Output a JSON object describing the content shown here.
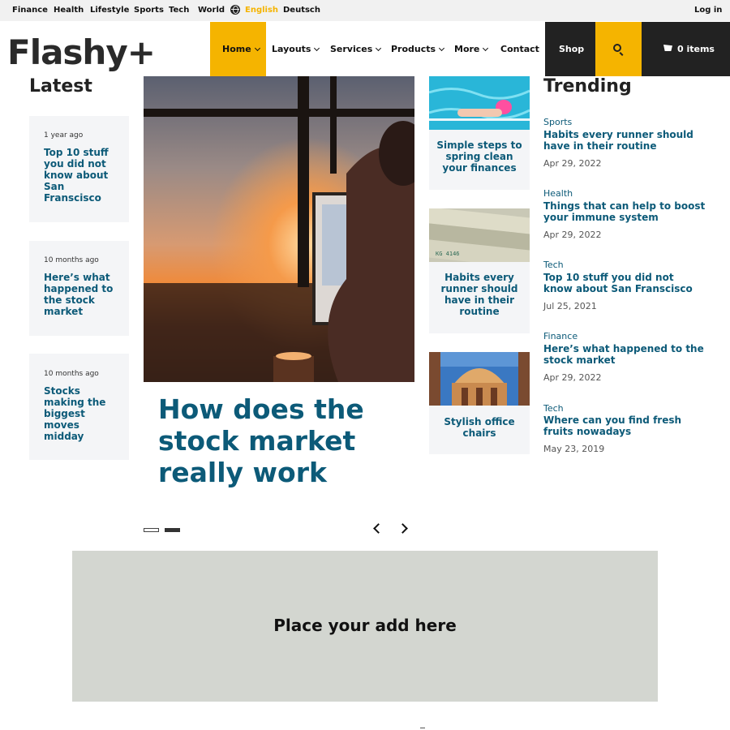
{
  "topbar": {
    "links": [
      "Finance",
      "Health",
      "Lifestyle",
      "Sports",
      "Tech",
      "World"
    ],
    "languages": [
      "English",
      "Deutsch"
    ],
    "login": "Log in"
  },
  "header": {
    "logo": "Flashy+",
    "nav": [
      "Home",
      "Layouts",
      "Services",
      "Products",
      "More",
      "Contact"
    ],
    "shop": "Shop",
    "cart": "0 items"
  },
  "latest": {
    "title": "Latest",
    "items": [
      {
        "ago": "1 year ago",
        "title": "Top 10 stuff you did not know about San Franscisco"
      },
      {
        "ago": "10 months ago",
        "title": "Here’s what happened to the stock market"
      },
      {
        "ago": "10 months ago",
        "title": "Stocks making the biggest moves midday"
      }
    ]
  },
  "hero": {
    "title": "How does the stock market really work"
  },
  "middle": {
    "items": [
      {
        "title": "Simple steps to spring clean your finances"
      },
      {
        "title": "Habits every runner should have in their routine"
      },
      {
        "title": "Stylish office chairs"
      }
    ]
  },
  "trending": {
    "title": "Trending",
    "items": [
      {
        "category": "Sports",
        "title": "Habits every runner should have in their routine",
        "date": "Apr 29, 2022"
      },
      {
        "category": "Health",
        "title": "Things that can help to boost your immune system",
        "date": "Apr 29, 2022"
      },
      {
        "category": "Tech",
        "title": "Top 10 stuff you did not know about San Franscisco",
        "date": "Jul 25, 2021"
      },
      {
        "category": "Finance",
        "title": "Here’s what happened to the stock market",
        "date": "Apr 29, 2022"
      },
      {
        "category": "Tech",
        "title": "Where can you find fresh fruits nowadays",
        "date": "May 23, 2019"
      }
    ]
  },
  "ad": {
    "text": "Place your add here"
  },
  "colors": {
    "accent": "#f5b400",
    "headline": "#0c5a78",
    "dark": "#222222",
    "ad_background": "#d3d6d0"
  }
}
